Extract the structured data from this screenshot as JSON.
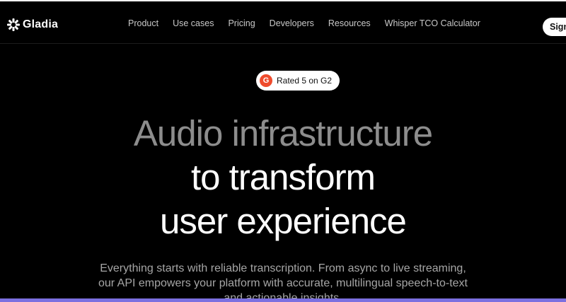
{
  "nav": {
    "logo_text": "Gladia",
    "links": [
      "Product",
      "Use cases",
      "Pricing",
      "Developers",
      "Resources",
      "Whisper TCO Calculator"
    ],
    "signin_label": "Sign"
  },
  "badge": {
    "icon_letter": "G",
    "text": "Rated 5 on G2"
  },
  "hero": {
    "line1": "Audio infrastructure",
    "line2": "to transform",
    "line3": "user experience",
    "subtitle_line1": "Everything starts with reliable transcription. From async to live streaming,",
    "subtitle_line2": "our API empowers your platform with accurate, multilingual speech-to-text",
    "subtitle_line3": "and actionable insights."
  },
  "colors": {
    "background": "#000000",
    "g2_red": "#ef4b2c",
    "accent_bar": "#7c6fe0"
  }
}
